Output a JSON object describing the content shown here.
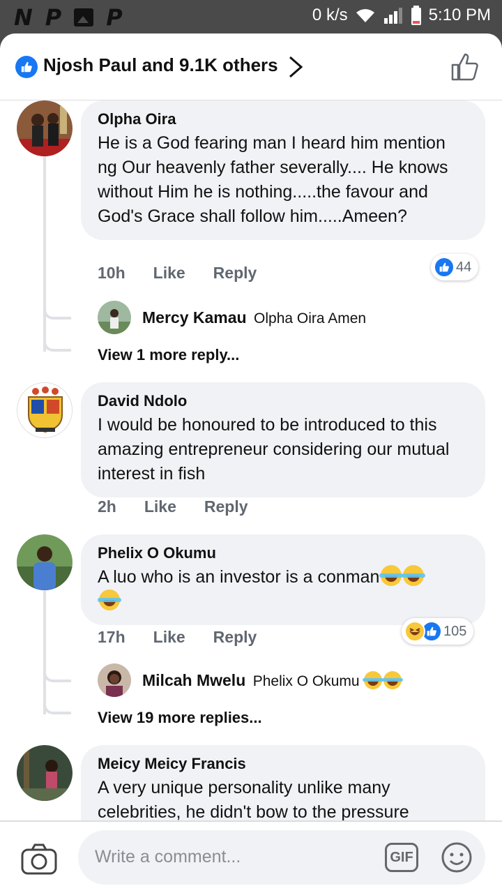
{
  "status_bar": {
    "left_glyphs": [
      "N",
      "P",
      "P"
    ],
    "net_speed": "0 k/s",
    "time": "5:10 PM"
  },
  "header": {
    "reactions_summary": "Njosh Paul and 9.1K others"
  },
  "comments": [
    {
      "author": "Olpha Oira",
      "text": "He is a God fearing man I heard him mention ng Our heavenly father severally.... He knows without Him he is nothing.....the favour and God's Grace shall follow him.....Ameen?",
      "time": "10h",
      "like_label": "Like",
      "reply_label": "Reply",
      "reaction_count": "44",
      "reply": {
        "author": "Mercy Kamau",
        "text": "Olpha Oira Amen"
      },
      "view_more": "View 1 more reply..."
    },
    {
      "author": "David Ndolo",
      "text": "I would be honoured to be introduced to this amazing entrepreneur considering our mutual interest in fish",
      "time": "2h",
      "like_label": "Like",
      "reply_label": "Reply"
    },
    {
      "author": "Phelix O Okumu",
      "text": "A luo who is an investor is a conman",
      "time": "17h",
      "like_label": "Like",
      "reply_label": "Reply",
      "reaction_count": "105",
      "reply": {
        "author": "Milcah Mwelu",
        "text": "Phelix O Okumu"
      },
      "view_more": "View 19 more replies..."
    },
    {
      "author": "Meicy Meicy Francis",
      "text": "A very unique personality unlike many celebrities, he didn't bow to the pressure"
    }
  ],
  "footer": {
    "placeholder": "Write a comment...",
    "gif_label": "GIF"
  },
  "colors": {
    "accent": "#1877f2",
    "bubble": "#f0f2f5",
    "meta": "#606770"
  }
}
